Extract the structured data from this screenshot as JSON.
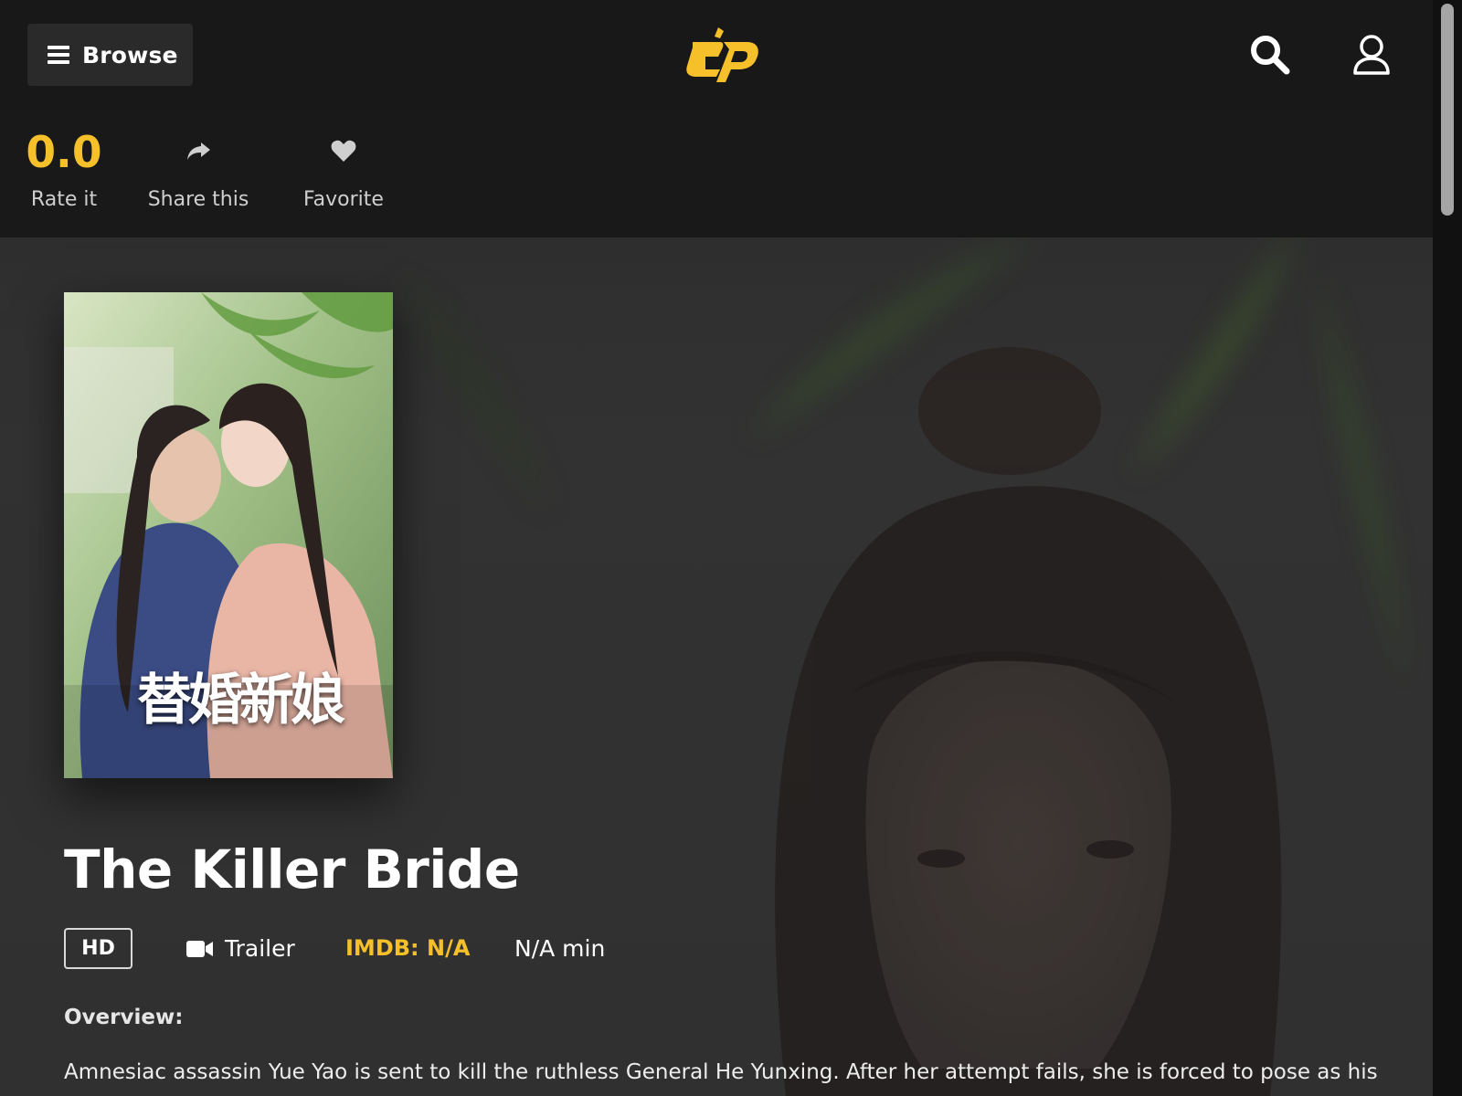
{
  "header": {
    "browse_label": "Browse",
    "logo_icon": "cp-logo",
    "search_icon": "search-icon",
    "user_icon": "user-icon"
  },
  "actions": {
    "rating_value": "0.0",
    "rate_label": "Rate it",
    "share_label": "Share this",
    "favorite_label": "Favorite"
  },
  "movie": {
    "poster_title_cn": "替婚新娘",
    "title": "The Killer Bride",
    "quality_badge": "HD",
    "trailer_label": "Trailer",
    "imdb": "IMDB: N/A",
    "runtime": "N/A min",
    "overview_heading": "Overview:",
    "overview_text": "Amnesiac assassin Yue Yao is sent to kill the ruthless General He Yunxing. After her attempt fails, she is forced to pose as his"
  },
  "colors": {
    "accent": "#f6c02a",
    "topbar": "#181818",
    "button_bg": "#2a2a2a"
  }
}
